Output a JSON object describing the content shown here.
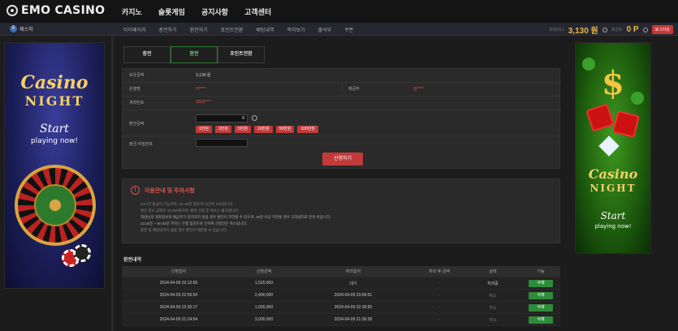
{
  "header": {
    "logo_text": "EMO CASINO",
    "nav": [
      "카지노",
      "슬롯게임",
      "공지사항",
      "고객센터"
    ]
  },
  "subbar": {
    "user_badge": "5",
    "user_name": "제스처",
    "nav": [
      "마이페이지",
      "충전하기",
      "환전하기",
      "포인트전환",
      "배팅내역",
      "쪽지보기",
      "출석부",
      "쿠폰"
    ],
    "money_label": "보유머니",
    "money_value": "3,130 원",
    "point_label": "포인트",
    "point_value": "0 P",
    "logout_label": "로그아웃"
  },
  "left_banner": {
    "casino": "Casino",
    "night": "NIGHT",
    "start": "Start",
    "playing": "playing now!"
  },
  "right_banner": {
    "dollar": "$",
    "casino": "Casino",
    "night": "NIGHT",
    "start": "Start",
    "playing": "playing now!"
  },
  "tabs": [
    {
      "label": "충전",
      "active": false
    },
    {
      "label": "환전",
      "active": true
    },
    {
      "label": "포인트전환",
      "active": false
    }
  ],
  "form": {
    "balance_label": "보유금액",
    "balance_value": "3,130 원",
    "bank_label": "은행명",
    "bank_value": "카****",
    "holder_label": "예금주",
    "holder_value": "김****",
    "account_label": "계좌번호",
    "account_value": "3333****",
    "amount_label": "환전금액",
    "amount_value": "0",
    "amount_buttons": [
      "1만원",
      "3만원",
      "5만원",
      "10만원",
      "50만원",
      "100만원"
    ],
    "password_label": "출금 비밀번호",
    "submit_label": "신청하기"
  },
  "notice": {
    "title": "이용안내 및 주의사항",
    "lines": [
      "24시간 출금이 가능하며, 10~30분 정도의 시간이 소요됩니다.",
      "환전 최소 금액은 10,000원이며, 환전 신청 후 취소는 불가합니다.",
      "회원님의 계좌정보와 예금주가 일치하지 않을 경우 환전이 지연될 수 있으며, 30분 이상 지연될 경우 고객센터로 문의 바랍니다.",
      "23:30분 ~ 00:30분 까지는 은행 점검으로 인하여 신청건은 취소됩니다.",
      "충전 및 배팅내역이 없을 경우 환전이 제한될 수 있습니다."
    ]
  },
  "history": {
    "title": "환전내역",
    "columns": [
      "신청일자",
      "신청금액",
      "처리일자",
      "처리 후 금액",
      "상태",
      "기능"
    ],
    "rows": [
      {
        "date": "2024-04-09 23:12:56",
        "amount": "1,520,000",
        "processed": "대기",
        "after": "-",
        "status": "처리중",
        "action": "삭제"
      },
      {
        "date": "2024-04-09 22:55:54",
        "amount": "2,490,000",
        "processed": "2024-04-09 23:00:01",
        "after": "-",
        "status": "취소",
        "action": "삭제"
      },
      {
        "date": "2024-04-09 22:30:17",
        "amount": "1,000,000",
        "processed": "2024-04-09 22:39:50",
        "after": "-",
        "status": "취소",
        "action": "삭제"
      },
      {
        "date": "2024-04-09 21:24:54",
        "amount": "3,000,000",
        "processed": "2024-04-09 21:36:28",
        "after": "-",
        "status": "취소",
        "action": "삭제"
      }
    ]
  },
  "colors": {
    "accent_red": "#c23a3a",
    "gold": "#e8b64c",
    "green_button": "#2e8b3a"
  }
}
